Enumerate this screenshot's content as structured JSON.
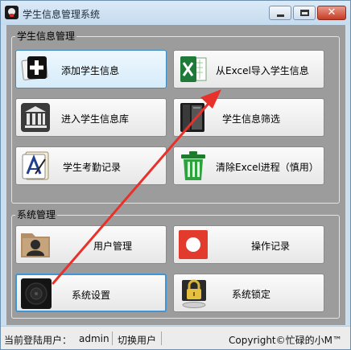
{
  "window": {
    "title": "学生信息管理系统",
    "controls": {
      "minimize": "—",
      "maximize": "□",
      "close": "✕"
    }
  },
  "groups": {
    "student": {
      "legend": "学生信息管理",
      "tiles": [
        {
          "label": "添加学生信息",
          "icon": "add-user-card-icon"
        },
        {
          "label": "从Excel导入学生信息",
          "icon": "excel-icon"
        },
        {
          "label": "进入学生信息库",
          "icon": "library-building-icon"
        },
        {
          "label": "学生信息筛选",
          "icon": "filter-cabinet-icon"
        },
        {
          "label": "学生考勤记录",
          "icon": "attendance-pen-icon"
        },
        {
          "label": "清除Excel进程（慎用）",
          "icon": "trash-bin-icon"
        }
      ]
    },
    "system": {
      "legend": "系统管理",
      "tiles": [
        {
          "label": "用户管理",
          "icon": "user-folder-icon"
        },
        {
          "label": "操作记录",
          "icon": "record-icon"
        },
        {
          "label": "系统设置",
          "icon": "settings-speaker-icon"
        },
        {
          "label": "系统锁定",
          "icon": "padlock-icon"
        }
      ]
    }
  },
  "status_bar": {
    "current_user_label": "当前登陆用户：",
    "current_user": "admin",
    "switch_user": "切换用户",
    "copyright": "Copyright©忙碌的小M™"
  },
  "colors": {
    "accent_arrow": "#e8312b",
    "panel_bg": "#9c9c9c",
    "selected_border": "#3f95d5"
  }
}
